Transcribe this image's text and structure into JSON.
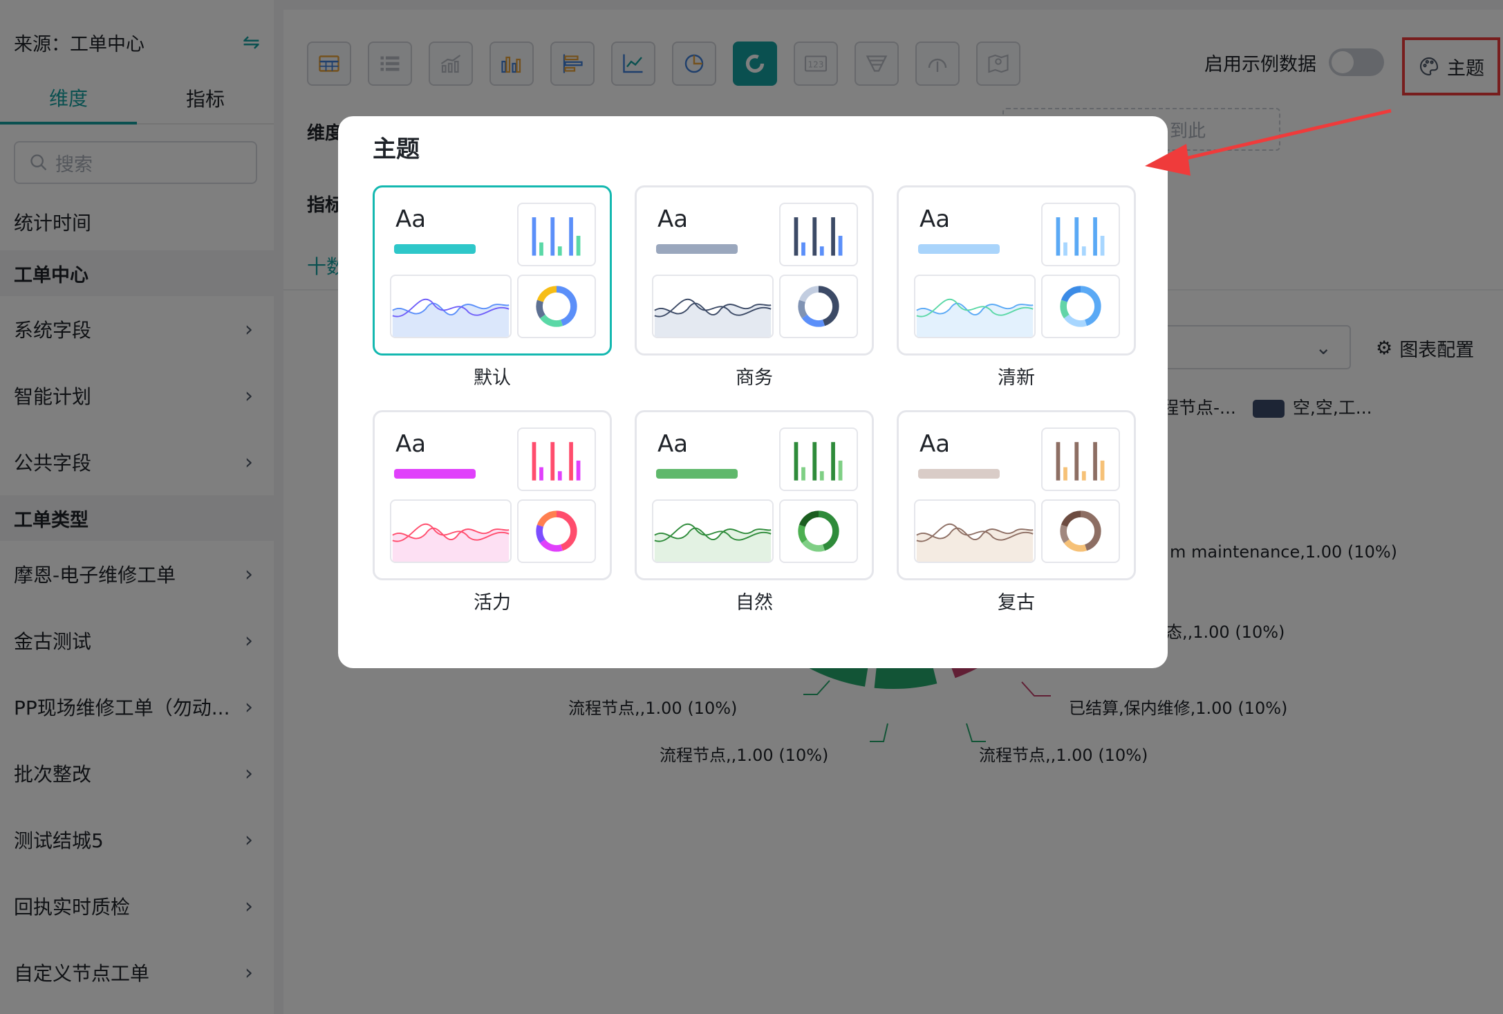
{
  "sidebar": {
    "source": "来源：工单中心",
    "tabs": [
      {
        "label": "维度",
        "active": true
      },
      {
        "label": "指标",
        "active": false
      }
    ],
    "search_placeholder": "搜索",
    "plain_item": "统计时间",
    "sections": [
      {
        "title": "工单中心",
        "items": [
          "系统字段",
          "智能计划",
          "公共字段"
        ]
      },
      {
        "title": "工单类型",
        "items": [
          "摩恩-电子维修工单",
          "金古测试",
          "PP现场维修工单（勿动...",
          "批次整改",
          "测试结城5",
          "回执实时质检",
          "自定义节点工单"
        ]
      }
    ]
  },
  "toolbar": {
    "chart_types": [
      "table-icon",
      "list-icon",
      "column-line-icon",
      "grouped-bar-icon",
      "horizontal-bar-icon",
      "line-icon",
      "pie-icon",
      "donut-icon",
      "number-icon",
      "funnel-icon",
      "gauge-icon",
      "map-icon"
    ],
    "active_index": 7,
    "demo_data_label": "启用示例数据",
    "demo_data_enabled": false,
    "theme_label": "主题"
  },
  "config": {
    "dimension_label": "维度",
    "metric_label": "指标",
    "drop_zone_text": "到此",
    "add_data_label": "十数",
    "chart_config_label": "图表配置"
  },
  "legend": {
    "items": [
      "程节点-...",
      "空,空,工..."
    ]
  },
  "chart_data": {
    "type": "pie",
    "labels": [
      "m maintenance,1.00 (10%)",
      "态,,1.00 (10%)",
      "已结算,保内维修,1.00 (10%)",
      "流程节点,,1.00 (10%)",
      "流程节点,,1.00 (10%)",
      "流程节点,,1.00 (10%)"
    ],
    "values": [
      1,
      1,
      1,
      1,
      1,
      1
    ]
  },
  "modal": {
    "title": "主题",
    "themes": [
      {
        "name": "默认",
        "accent": "#2ec7c9",
        "colors": [
          "#5b8ff9",
          "#5ad8a6",
          "#5d7092",
          "#f6bd16",
          "#6f5ef9"
        ],
        "line2": "#6f5ef9",
        "fill": "#dbe7fb",
        "selected": true
      },
      {
        "name": "商务",
        "accent": "#9aa7bd",
        "colors": [
          "#3c4a66",
          "#5b8ff9",
          "#8093b3",
          "#c2cde0",
          "#2f3a52"
        ],
        "line2": "#3c4a66",
        "fill": "#e4e9f1",
        "selected": false
      },
      {
        "name": "清新",
        "accent": "#a9d4fb",
        "colors": [
          "#5aa9f5",
          "#a7d6ff",
          "#62d4a8",
          "#3b8be6",
          "#bde3ff"
        ],
        "line2": "#5ad8a6",
        "fill": "#e3f1fd",
        "selected": false
      },
      {
        "name": "活力",
        "accent": "#e040fb",
        "colors": [
          "#ff4d6d",
          "#e040fb",
          "#7c4dff",
          "#ff7f50",
          "#ff4081"
        ],
        "line2": "#ff4d6d",
        "fill": "#fde0f3",
        "selected": false
      },
      {
        "name": "自然",
        "accent": "#5fb86b",
        "colors": [
          "#2e8b3a",
          "#7fcf85",
          "#4caf50",
          "#1b5e20",
          "#a5d6a7"
        ],
        "line2": "#2e8b3a",
        "fill": "#e3f2e3",
        "selected": false
      },
      {
        "name": "复古",
        "accent": "#d9ccc7",
        "colors": [
          "#8d6e63",
          "#f6c177",
          "#a1887f",
          "#6d4c41",
          "#ffd9a0"
        ],
        "line2": "#8d6e63",
        "fill": "#f4ebe2",
        "selected": false
      }
    ]
  }
}
